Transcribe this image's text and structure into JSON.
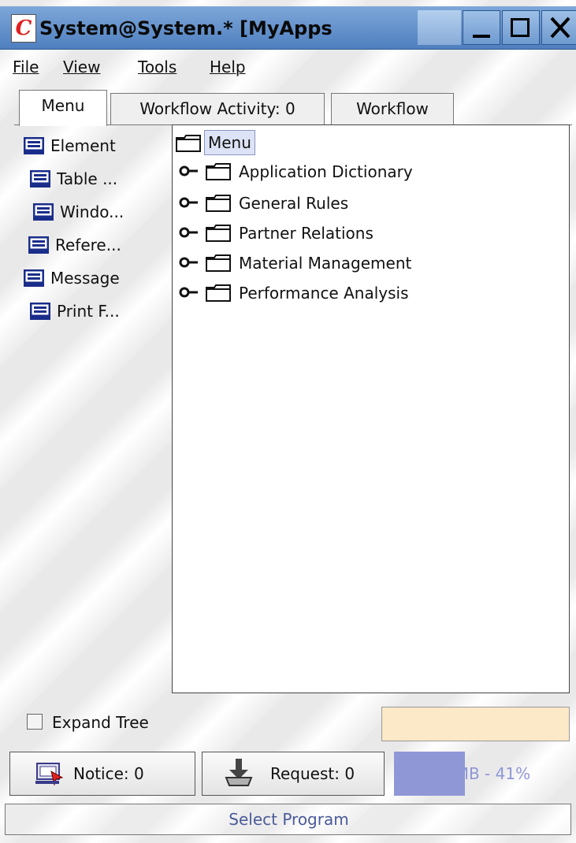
{
  "window": {
    "title": "System@System.* [MyApps",
    "logo_letter": "C"
  },
  "menubar": {
    "items": [
      "File",
      "View",
      "Tools",
      "Help"
    ]
  },
  "tabs": [
    {
      "label": "Menu",
      "selected": true
    },
    {
      "label": "Workflow Activity: 0",
      "selected": false
    },
    {
      "label": "Workflow",
      "selected": false
    }
  ],
  "shortcuts": [
    {
      "label": "Element",
      "icon": "monitor-icon"
    },
    {
      "label": "Table ...",
      "icon": "monitor-icon"
    },
    {
      "label": "Windo...",
      "icon": "monitor-icon"
    },
    {
      "label": "Refere...",
      "icon": "monitor-icon"
    },
    {
      "label": "Message",
      "icon": "monitor-icon"
    },
    {
      "label": "Print F...",
      "icon": "monitor-icon"
    }
  ],
  "tree": {
    "root": {
      "label": "Menu",
      "selected": true
    },
    "nodes": [
      {
        "label": "Application Dictionary",
        "expanded": false
      },
      {
        "label": "General Rules",
        "expanded": false
      },
      {
        "label": "Partner Relations",
        "expanded": false
      },
      {
        "label": "Material Management",
        "expanded": false
      },
      {
        "label": "Performance Analysis",
        "expanded": false
      }
    ]
  },
  "expand_tree": {
    "label": "Expand Tree",
    "checked": false
  },
  "search": {
    "value": "",
    "background": "#fbe9c7"
  },
  "buttons": {
    "notice": "Notice: 0",
    "request": "Request: 0"
  },
  "memory": {
    "label": "32 MB - 41%",
    "used_percent": 41,
    "color": "#8f97d6"
  },
  "status": {
    "text": "Select Program"
  },
  "colors": {
    "title_bar": "#5b8bc9",
    "tree_selection": "#dde3f6",
    "status_text": "#4a5a9a"
  }
}
